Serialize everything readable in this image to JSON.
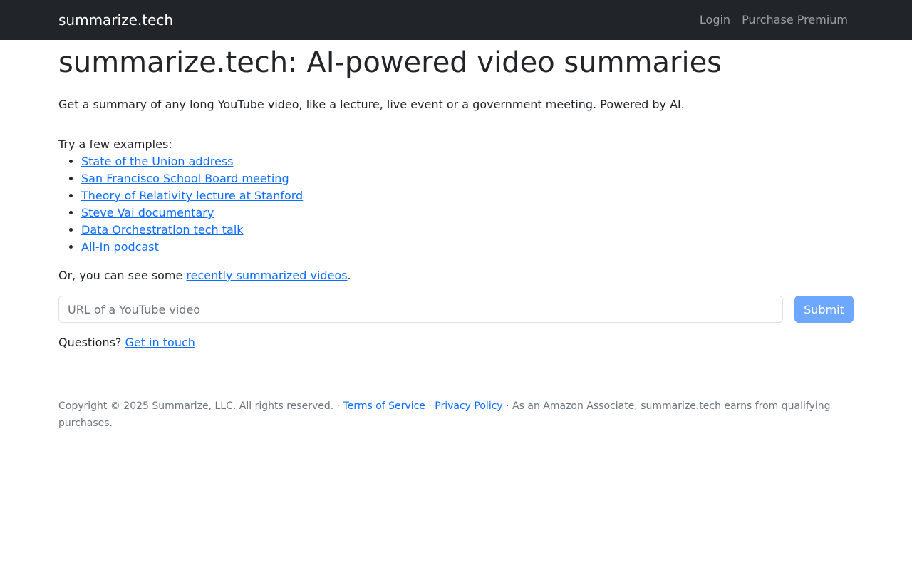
{
  "navbar": {
    "brand": "summarize.tech",
    "links": [
      "Login",
      "Purchase Premium"
    ]
  },
  "main": {
    "title": "summarize.tech: AI-powered video summaries",
    "lead": "Get a summary of any long YouTube video, like a lecture, live event or a government meeting. Powered by AI.",
    "examples_label": "Try a few examples:",
    "examples": [
      "State of the Union address",
      "San Francisco School Board meeting",
      "Theory of Relativity lecture at Stanford",
      "Steve Vai documentary",
      "Data Orchestration tech talk",
      "All-In podcast"
    ],
    "recent_prefix": "Or, you can see some ",
    "recent_link": "recently summarized videos",
    "recent_suffix": ".",
    "url_placeholder": "URL of a YouTube video",
    "submit_label": "Submit",
    "questions_prefix": "Questions? ",
    "questions_link": "Get in touch"
  },
  "footer": {
    "copyright": "Copyright © 2025 Summarize, LLC. All rights reserved. · ",
    "terms": "Terms of Service",
    "sep": " · ",
    "privacy": "Privacy Policy",
    "amazon": " · As an Amazon Associate, summarize.tech earns from qualifying purchases."
  },
  "colors": {
    "navbar_bg": "#212529",
    "link": "#0d6efd",
    "button": "#6ea8fe"
  }
}
